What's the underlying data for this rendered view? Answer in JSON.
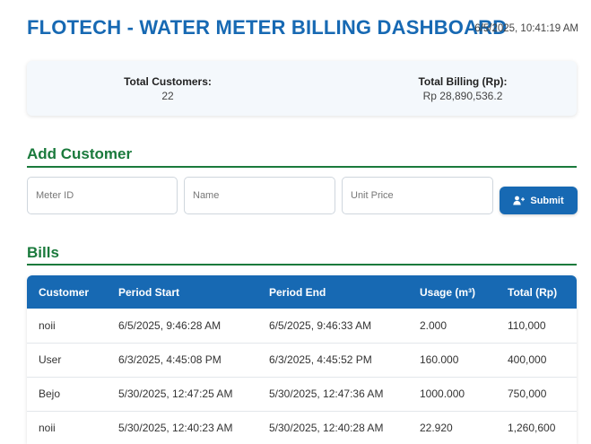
{
  "header": {
    "title": "FLOTECH - WATER METER BILLING DASHBOARD",
    "datetime": "6/5/2025, 10:41:19 AM"
  },
  "summary": {
    "customers_label": "Total Customers:",
    "customers_value": "22",
    "billing_label": "Total Billing (Rp):",
    "billing_value": "Rp 28,890,536.2"
  },
  "add_customer": {
    "title": "Add Customer",
    "meter_id_placeholder": "Meter ID",
    "name_placeholder": "Name",
    "unit_price_placeholder": "Unit Price",
    "submit_label": "Submit"
  },
  "bills": {
    "title": "Bills",
    "columns": [
      "Customer",
      "Period Start",
      "Period End",
      "Usage (m³)",
      "Total (Rp)"
    ],
    "rows": [
      [
        "noii",
        "6/5/2025, 9:46:28 AM",
        "6/5/2025, 9:46:33 AM",
        "2.000",
        "110,000"
      ],
      [
        "User",
        "6/3/2025, 4:45:08 PM",
        "6/3/2025, 4:45:52 PM",
        "160.000",
        "400,000"
      ],
      [
        "Bejo",
        "5/30/2025, 12:47:25 AM",
        "5/30/2025, 12:47:36 AM",
        "1000.000",
        "750,000"
      ],
      [
        "noii",
        "5/30/2025, 12:40:23 AM",
        "5/30/2025, 12:40:28 AM",
        "22.920",
        "1,260,600"
      ]
    ]
  },
  "colors": {
    "primary": "#1769b3",
    "section": "#1a7a3c",
    "summary_bg": "#f4f8fc"
  },
  "icons": {
    "submit": "user-plus-icon"
  }
}
